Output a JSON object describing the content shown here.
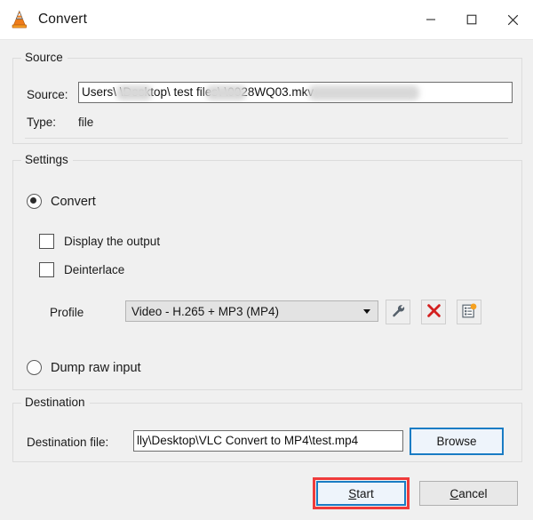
{
  "window": {
    "title": "Convert",
    "icon": "vlc-cone-icon",
    "controls": {
      "minimize": "minimize-icon",
      "maximize": "maximize-icon",
      "close": "close-icon"
    }
  },
  "source": {
    "group_label": "Source",
    "source_label": "Source:",
    "source_value": "Users\\       \\Desktop\\        test files\\                    \\0028WQ03.mkv",
    "type_label": "Type:",
    "type_value": "file"
  },
  "settings": {
    "group_label": "Settings",
    "convert_radio": "Convert",
    "convert_selected": true,
    "display_output_checkbox": "Display the output",
    "display_output_checked": false,
    "deinterlace_checkbox": "Deinterlace",
    "deinterlace_checked": false,
    "profile_label": "Profile",
    "profile_value": "Video - H.265 + MP3 (MP4)",
    "profile_options": [
      "Video - H.265 + MP3 (MP4)"
    ],
    "edit_profile_icon": "wrench-icon",
    "delete_profile_icon": "red-x-icon",
    "new_profile_icon": "new-profile-icon",
    "dump_raw_radio": "Dump raw input",
    "dump_raw_selected": false
  },
  "destination": {
    "group_label": "Destination",
    "file_label": "Destination file:",
    "file_value": "lly\\Desktop\\VLC Convert to MP4\\test.mp4",
    "browse_label": "Browse"
  },
  "footer": {
    "start_mnemonic": "S",
    "start_rest": "tart",
    "cancel_mnemonic": "C",
    "cancel_rest": "ancel"
  },
  "colors": {
    "window_bg": "#f0f0f0",
    "titlebar_bg": "#ffffff",
    "focus_blue": "#1a7cc4",
    "annotation_red": "#ef3b3b",
    "delete_red": "#d32020",
    "badge_orange": "#f5a01e"
  }
}
